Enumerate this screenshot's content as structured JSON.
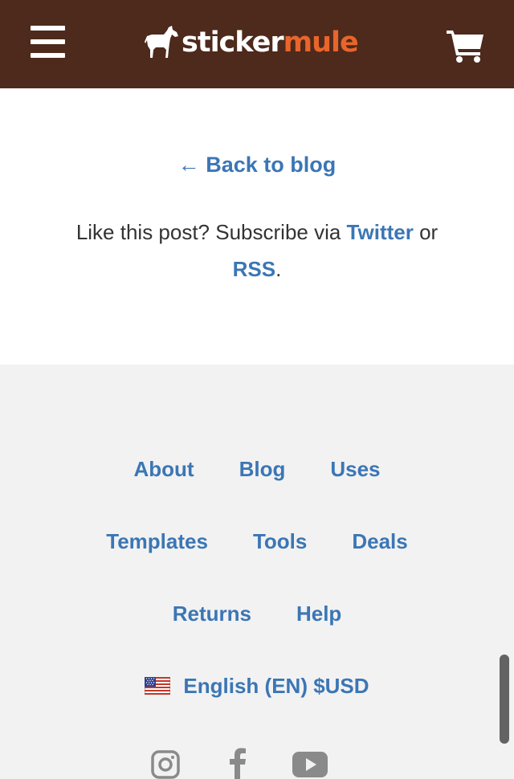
{
  "header": {
    "logo": {
      "part1": "sticker",
      "part2": "mule"
    },
    "menu_icon": "hamburger-menu-icon",
    "cart_icon": "shopping-cart-icon"
  },
  "content": {
    "back_link": "← Back to blog",
    "subscribe": {
      "text_before": "Like this post? Subscribe via ",
      "twitter_label": "Twitter",
      "text_middle": " or ",
      "rss_label": "RSS",
      "text_after": "."
    }
  },
  "footer": {
    "links_row1": [
      "About",
      "Blog",
      "Uses"
    ],
    "links_row2": [
      "Templates",
      "Tools",
      "Deals"
    ],
    "links_row3": [
      "Returns",
      "Help"
    ],
    "locale": {
      "flag_icon": "us-flag-icon",
      "label": "English (EN) $USD"
    },
    "social": [
      "instagram-icon",
      "facebook-icon",
      "youtube-icon"
    ]
  },
  "colors": {
    "header_bg": "#4d2a1c",
    "accent": "#e8652b",
    "link": "#3b76b5",
    "footer_bg": "#f2f2f2"
  }
}
